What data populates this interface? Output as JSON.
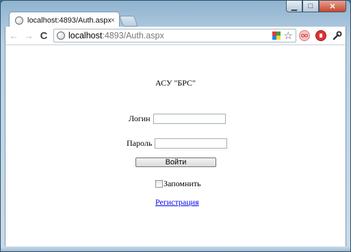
{
  "window": {
    "controls": {
      "minimize": "▁",
      "maximize": "□",
      "close": "✕"
    }
  },
  "tab": {
    "title": "localhost:4893/Auth.aspx",
    "close": "×",
    "icon": "globe-icon"
  },
  "toolbar": {
    "back": "←",
    "forward": "→",
    "reload": "C",
    "url_host": "localhost",
    "url_rest": ":4893/Auth.aspx",
    "star": "☆"
  },
  "page": {
    "title": "АСУ \"БРС\"",
    "login_label": "Логин",
    "login_value": "",
    "password_label": "Пароль",
    "password_value": "",
    "submit_label": "Войти",
    "remember_label": "Запомнить",
    "remember_checked": false,
    "register_link": "Регистрация"
  },
  "colors": {
    "link": "#0000ee",
    "window_frame": "#b9d1e4",
    "close_button": "#c7462d"
  }
}
